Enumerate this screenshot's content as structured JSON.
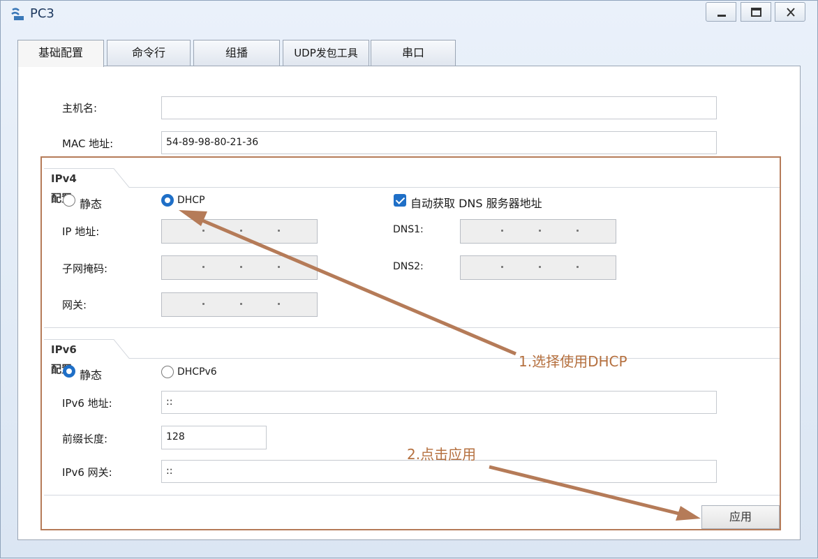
{
  "window": {
    "title": "PC3"
  },
  "tabs": [
    {
      "label": "基础配置",
      "active": true
    },
    {
      "label": "命令行",
      "active": false
    },
    {
      "label": "组播",
      "active": false
    },
    {
      "label": "UDP发包工具",
      "active": false
    },
    {
      "label": "串口",
      "active": false
    }
  ],
  "basic": {
    "hostname_label": "主机名:",
    "hostname_value": "",
    "mac_label": "MAC 地址:",
    "mac_value": "54-89-98-80-21-36"
  },
  "ipv4": {
    "header": "IPv4 配置",
    "static_label": "静态",
    "dhcp_label": "DHCP",
    "mode": "DHCP",
    "auto_dns_label": "自动获取 DNS 服务器地址",
    "auto_dns_checked": true,
    "ip_label": "IP 地址:",
    "mask_label": "子网掩码:",
    "gateway_label": "网关:",
    "dns1_label": "DNS1:",
    "dns2_label": "DNS2:"
  },
  "ipv6": {
    "header": "IPv6 配置",
    "static_label": "静态",
    "dhcp_label": "DHCPv6",
    "mode": "静态",
    "addr_label": "IPv6 地址:",
    "addr_value": "::",
    "prefix_label": "前缀长度:",
    "prefix_value": "128",
    "gateway_label": "IPv6 网关:",
    "gateway_value": "::"
  },
  "apply_label": "应用",
  "annotations": {
    "step1": "1.选择使用DHCP",
    "step2": "2.点击应用",
    "color": "#b57b58"
  }
}
